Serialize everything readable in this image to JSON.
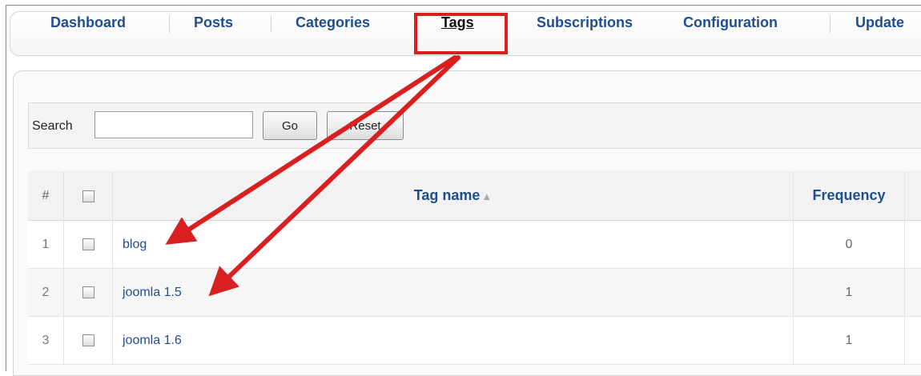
{
  "nav": {
    "tabs": [
      {
        "label": "Dashboard"
      },
      {
        "label": "Posts"
      },
      {
        "label": "Categories"
      },
      {
        "label": "Tags",
        "active": true
      },
      {
        "label": "Subscriptions"
      },
      {
        "label": "Configuration"
      },
      {
        "label": "Update"
      }
    ]
  },
  "search": {
    "label": "Search",
    "value": "",
    "go_label": "Go",
    "reset_label": "Reset"
  },
  "table": {
    "headers": {
      "number": "#",
      "tag_name": "Tag name",
      "frequency": "Frequency"
    },
    "rows": [
      {
        "number": "1",
        "tag_name": "blog",
        "frequency": "0"
      },
      {
        "number": "2",
        "tag_name": "joomla 1.5",
        "frequency": "1"
      },
      {
        "number": "3",
        "tag_name": "joomla 1.6",
        "frequency": "1"
      }
    ]
  },
  "colors": {
    "link": "#1f4e8c",
    "annotation": "#d91f1f"
  },
  "icons": {
    "sort": "sort-up-icon",
    "checkbox": "checkbox-icon"
  }
}
